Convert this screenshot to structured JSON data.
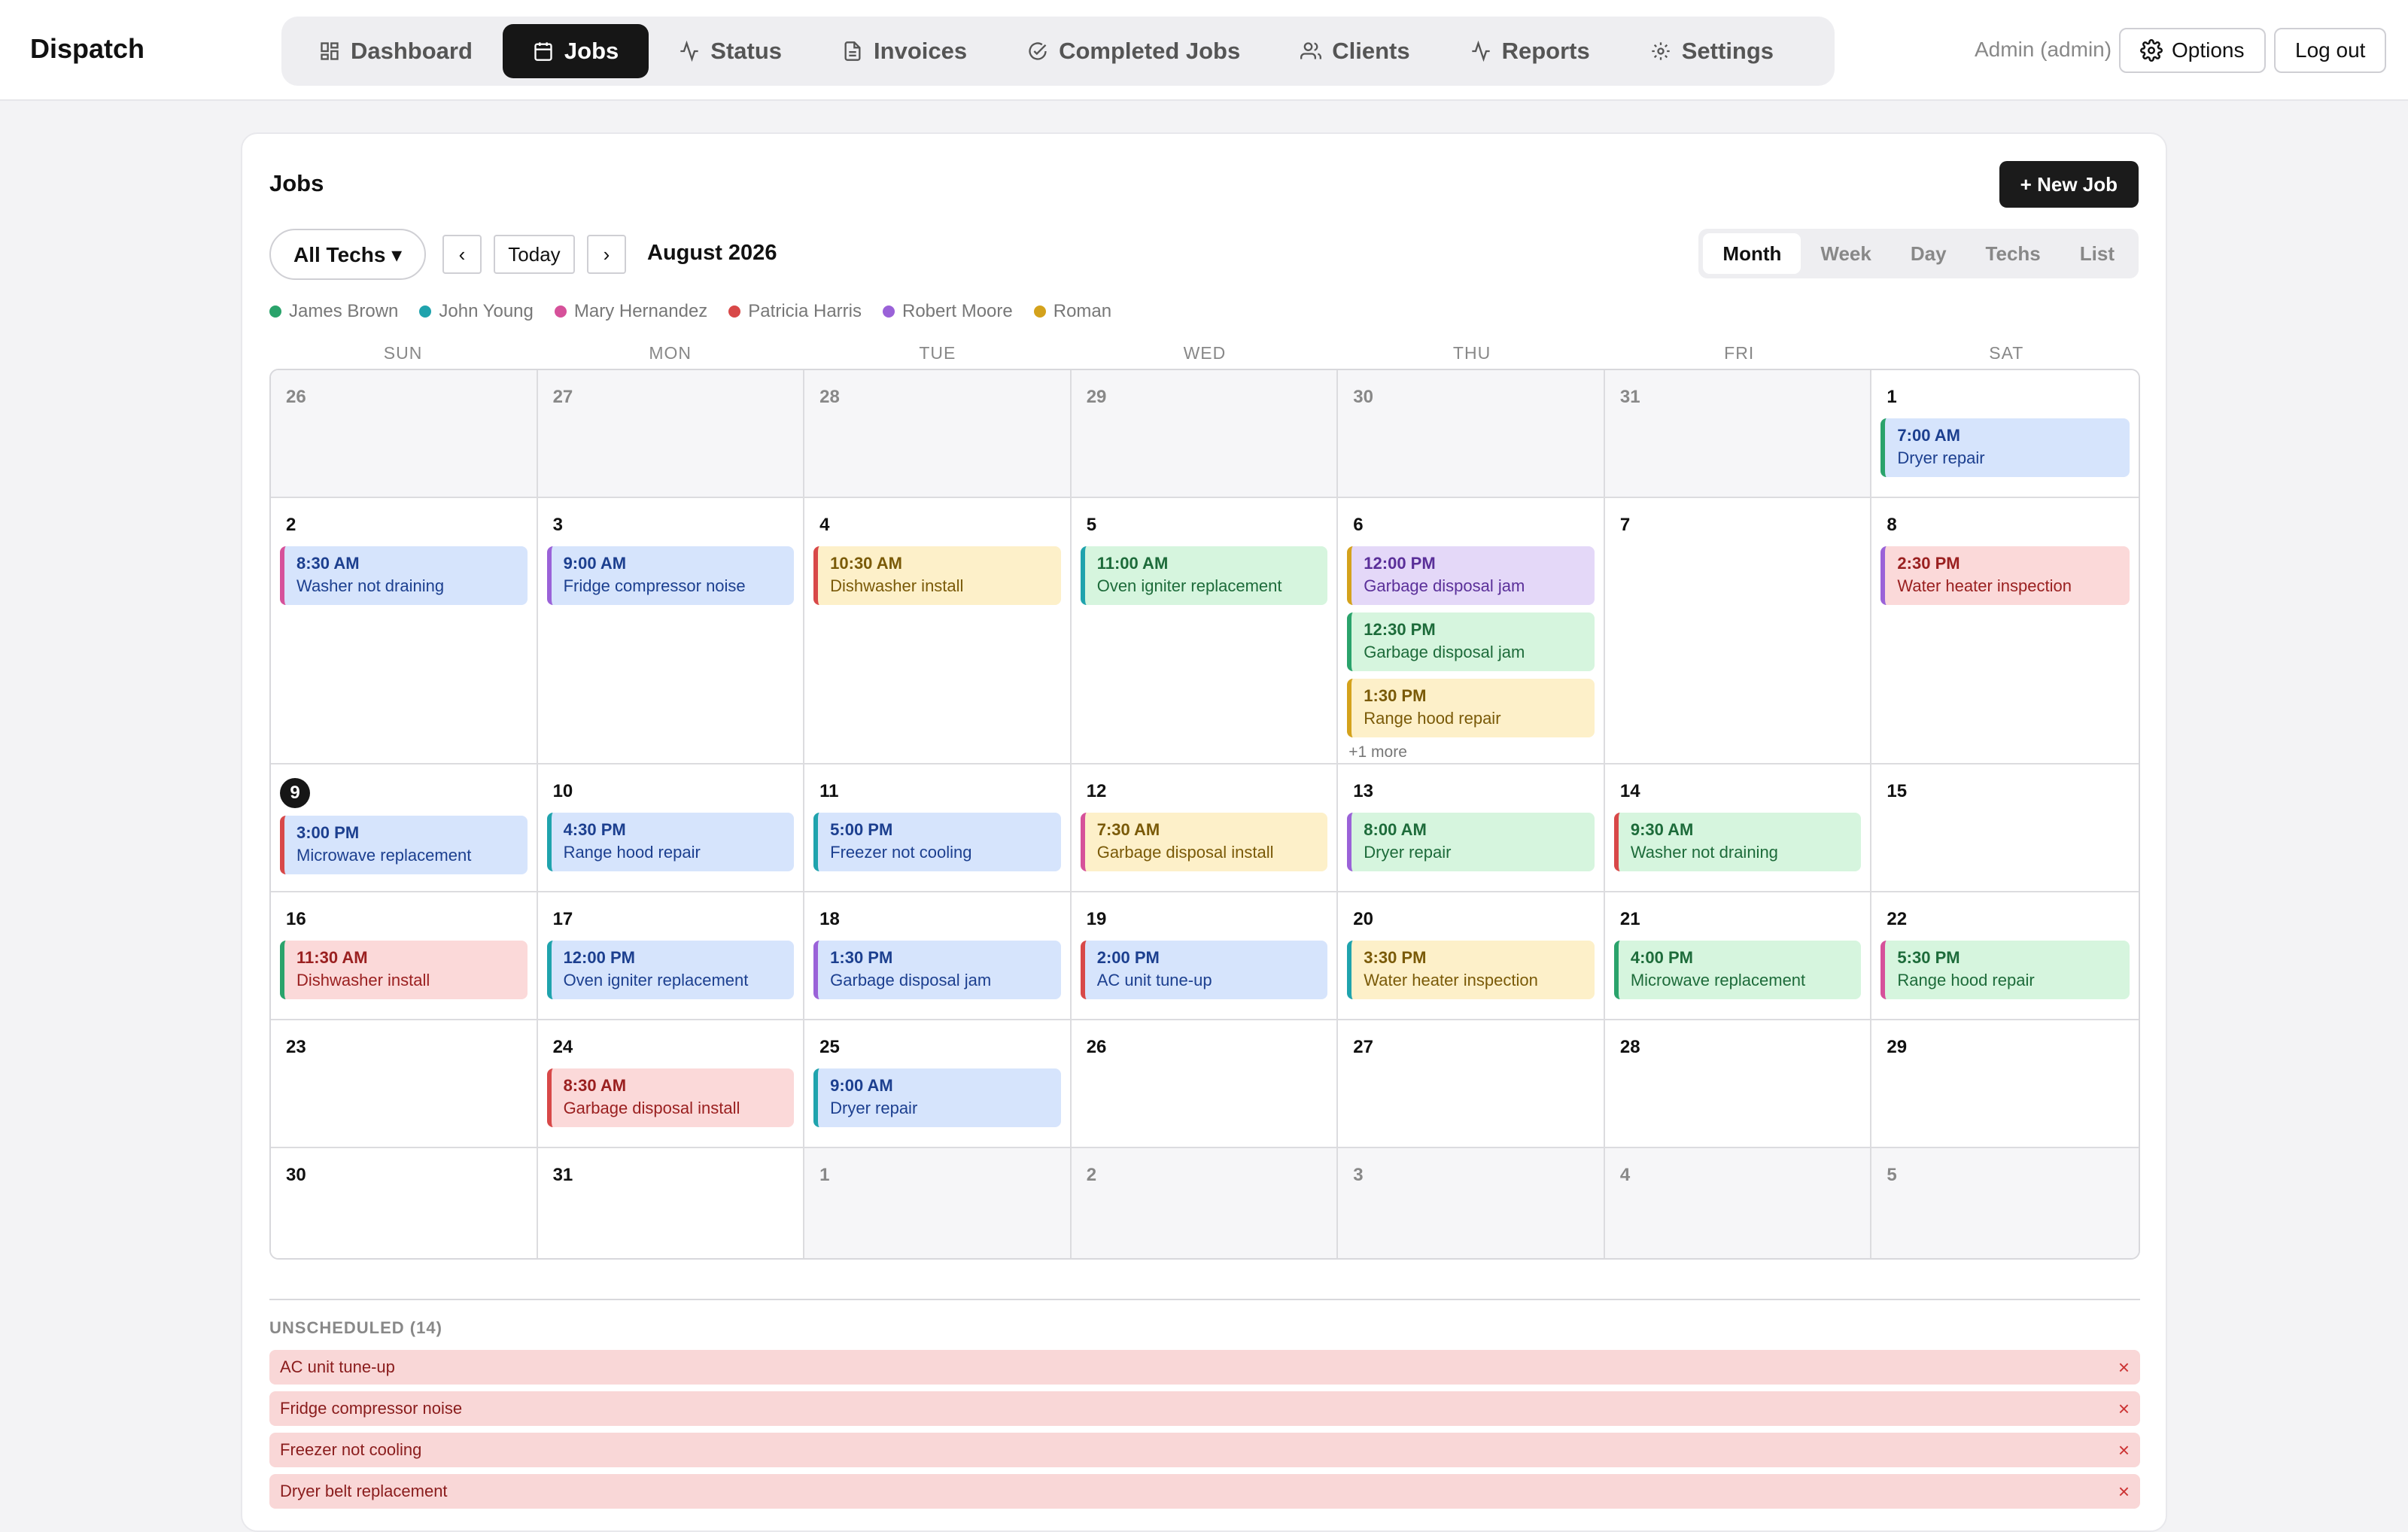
{
  "app": {
    "title": "Dispatch"
  },
  "nav": [
    {
      "label": "Dashboard",
      "icon": "dashboard-icon"
    },
    {
      "label": "Jobs",
      "icon": "calendar-icon",
      "active": true
    },
    {
      "label": "Status",
      "icon": "activity-icon"
    },
    {
      "label": "Invoices",
      "icon": "document-icon"
    },
    {
      "label": "Completed Jobs",
      "icon": "check-circle-icon"
    },
    {
      "label": "Clients",
      "icon": "users-icon"
    },
    {
      "label": "Reports",
      "icon": "activity-icon"
    },
    {
      "label": "Settings",
      "icon": "gear-icon"
    }
  ],
  "header": {
    "user": "Admin (admin)",
    "options_label": "Options",
    "logout_label": "Log out"
  },
  "page": {
    "title": "Jobs",
    "new_job_label": "+ New Job",
    "tech_filter": "All Techs ▾",
    "prev_label": "‹",
    "today_label": "Today",
    "next_label": "›",
    "month_label": "August 2026"
  },
  "view_tabs": [
    {
      "label": "Month",
      "active": true
    },
    {
      "label": "Week"
    },
    {
      "label": "Day"
    },
    {
      "label": "Techs"
    },
    {
      "label": "List"
    }
  ],
  "techs": [
    {
      "name": "James Brown",
      "color": "#2aa36b"
    },
    {
      "name": "John Young",
      "color": "#1fa3ad"
    },
    {
      "name": "Mary Hernandez",
      "color": "#d6519a"
    },
    {
      "name": "Patricia Harris",
      "color": "#d84848"
    },
    {
      "name": "Robert Moore",
      "color": "#9a62d8"
    },
    {
      "name": "Roman",
      "color": "#d4a21c"
    }
  ],
  "weekdays": [
    "SUN",
    "MON",
    "TUE",
    "WED",
    "THU",
    "FRI",
    "SAT"
  ],
  "calendar": {
    "today": "9",
    "weeks": [
      [
        {
          "day": "26",
          "out": true,
          "events": []
        },
        {
          "day": "27",
          "out": true,
          "events": []
        },
        {
          "day": "28",
          "out": true,
          "events": []
        },
        {
          "day": "29",
          "out": true,
          "events": []
        },
        {
          "day": "30",
          "out": true,
          "events": []
        },
        {
          "day": "31",
          "out": true,
          "events": []
        },
        {
          "day": "1",
          "events": [
            {
              "time": "7:00 AM",
              "title": "Dryer repair",
              "theme": "blue",
              "bar": "#2aa36b"
            }
          ]
        }
      ],
      [
        {
          "day": "2",
          "events": [
            {
              "time": "8:30 AM",
              "title": "Washer not draining",
              "theme": "blue",
              "bar": "#d6519a"
            }
          ]
        },
        {
          "day": "3",
          "events": [
            {
              "time": "9:00 AM",
              "title": "Fridge compressor noise",
              "theme": "blue",
              "bar": "#9a62d8"
            }
          ]
        },
        {
          "day": "4",
          "events": [
            {
              "time": "10:30 AM",
              "title": "Dishwasher install",
              "theme": "yellow",
              "bar": "#d84848"
            }
          ]
        },
        {
          "day": "5",
          "events": [
            {
              "time": "11:00 AM",
              "title": "Oven igniter replacement",
              "theme": "green",
              "bar": "#1fa3ad"
            }
          ]
        },
        {
          "day": "6",
          "events": [
            {
              "time": "12:00 PM",
              "title": "Garbage disposal jam",
              "theme": "purple",
              "bar": "#d4a21c"
            },
            {
              "time": "12:30 PM",
              "title": "Garbage disposal jam",
              "theme": "green",
              "bar": "#2aa36b"
            },
            {
              "time": "1:30 PM",
              "title": "Range hood repair",
              "theme": "yellow",
              "bar": "#d4a21c"
            }
          ],
          "more": "+1 more"
        },
        {
          "day": "7",
          "events": []
        },
        {
          "day": "8",
          "events": [
            {
              "time": "2:30 PM",
              "title": "Water heater inspection",
              "theme": "red",
              "bar": "#9a62d8"
            }
          ]
        }
      ],
      [
        {
          "day": "9",
          "events": [
            {
              "time": "3:00 PM",
              "title": "Microwave replacement",
              "theme": "blue",
              "bar": "#d84848"
            }
          ]
        },
        {
          "day": "10",
          "events": [
            {
              "time": "4:30 PM",
              "title": "Range hood repair",
              "theme": "blue",
              "bar": "#1fa3ad"
            }
          ]
        },
        {
          "day": "11",
          "events": [
            {
              "time": "5:00 PM",
              "title": "Freezer not cooling",
              "theme": "blue",
              "bar": "#1fa3ad"
            }
          ]
        },
        {
          "day": "12",
          "events": [
            {
              "time": "7:30 AM",
              "title": "Garbage disposal install",
              "theme": "yellow",
              "bar": "#d6519a"
            }
          ]
        },
        {
          "day": "13",
          "events": [
            {
              "time": "8:00 AM",
              "title": "Dryer repair",
              "theme": "green",
              "bar": "#9a62d8"
            }
          ]
        },
        {
          "day": "14",
          "events": [
            {
              "time": "9:30 AM",
              "title": "Washer not draining",
              "theme": "green",
              "bar": "#d84848"
            }
          ]
        },
        {
          "day": "15",
          "events": []
        }
      ],
      [
        {
          "day": "16",
          "events": [
            {
              "time": "11:30 AM",
              "title": "Dishwasher install",
              "theme": "red",
              "bar": "#2aa36b"
            }
          ]
        },
        {
          "day": "17",
          "events": [
            {
              "time": "12:00 PM",
              "title": "Oven igniter replacement",
              "theme": "blue",
              "bar": "#1fa3ad"
            }
          ]
        },
        {
          "day": "18",
          "events": [
            {
              "time": "1:30 PM",
              "title": "Garbage disposal jam",
              "theme": "blue",
              "bar": "#9a62d8"
            }
          ]
        },
        {
          "day": "19",
          "events": [
            {
              "time": "2:00 PM",
              "title": "AC unit tune-up",
              "theme": "blue",
              "bar": "#d84848"
            }
          ]
        },
        {
          "day": "20",
          "events": [
            {
              "time": "3:30 PM",
              "title": "Water heater inspection",
              "theme": "yellow",
              "bar": "#1fa3ad"
            }
          ]
        },
        {
          "day": "21",
          "events": [
            {
              "time": "4:00 PM",
              "title": "Microwave replacement",
              "theme": "green",
              "bar": "#2aa36b"
            }
          ]
        },
        {
          "day": "22",
          "events": [
            {
              "time": "5:30 PM",
              "title": "Range hood repair",
              "theme": "green",
              "bar": "#d6519a"
            }
          ]
        }
      ],
      [
        {
          "day": "23",
          "events": []
        },
        {
          "day": "24",
          "events": [
            {
              "time": "8:30 AM",
              "title": "Garbage disposal install",
              "theme": "red",
              "bar": "#d84848"
            }
          ]
        },
        {
          "day": "25",
          "events": [
            {
              "time": "9:00 AM",
              "title": "Dryer repair",
              "theme": "blue",
              "bar": "#1fa3ad"
            }
          ]
        },
        {
          "day": "26",
          "events": []
        },
        {
          "day": "27",
          "events": []
        },
        {
          "day": "28",
          "events": []
        },
        {
          "day": "29",
          "events": []
        }
      ],
      [
        {
          "day": "30",
          "events": []
        },
        {
          "day": "31",
          "events": []
        },
        {
          "day": "1",
          "out": true,
          "events": []
        },
        {
          "day": "2",
          "out": true,
          "events": []
        },
        {
          "day": "3",
          "out": true,
          "events": []
        },
        {
          "day": "4",
          "out": true,
          "events": []
        },
        {
          "day": "5",
          "out": true,
          "events": []
        }
      ]
    ]
  },
  "themes": {
    "blue": {
      "bg": "#d6e4fc",
      "text": "#1c3f8f"
    },
    "green": {
      "bg": "#d6f5de",
      "text": "#1d6b3a"
    },
    "yellow": {
      "bg": "#fdf0c9",
      "text": "#7a5a08"
    },
    "red": {
      "bg": "#fbd9d9",
      "text": "#9a2020"
    },
    "purple": {
      "bg": "#e4d8f8",
      "text": "#5a2f99"
    }
  },
  "unscheduled": {
    "title": "UNSCHEDULED (14)",
    "remove_label": "×",
    "items": [
      "AC unit tune-up",
      "Fridge compressor noise",
      "Freezer not cooling",
      "Dryer belt replacement"
    ]
  }
}
